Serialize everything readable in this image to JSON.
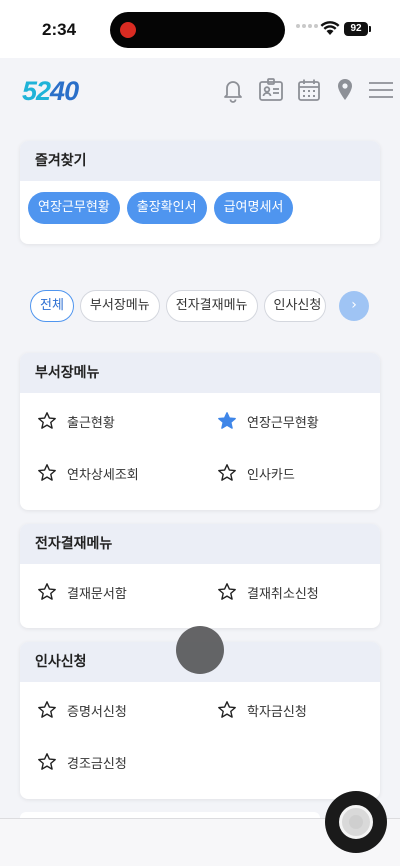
{
  "status": {
    "time": "2:34",
    "battery": "92"
  },
  "brand": {
    "logo_a": "52",
    "logo_b": "40"
  },
  "header_icons": [
    "bell-icon",
    "id-card-icon",
    "calendar-icon",
    "location-pin-icon",
    "hamburger-menu-icon"
  ],
  "favorites": {
    "title": "즐겨찾기",
    "chips": [
      "연장근무현황",
      "출장확인서",
      "급여명세서"
    ]
  },
  "tabs": [
    "전체",
    "부서장메뉴",
    "전자결재메뉴",
    "인사신청"
  ],
  "tab_next_glyph": "›",
  "sections": [
    {
      "title": "부서장메뉴",
      "items": [
        {
          "label": "출근현황",
          "starred": false
        },
        {
          "label": "연장근무현황",
          "starred": true
        },
        {
          "label": "연차상세조회",
          "starred": false
        },
        {
          "label": "인사카드",
          "starred": false
        }
      ]
    },
    {
      "title": "전자결재메뉴",
      "items": [
        {
          "label": "결재문서함",
          "starred": false
        },
        {
          "label": "결재취소신청",
          "starred": false
        }
      ]
    },
    {
      "title": "인사신청",
      "items": [
        {
          "label": "증명서신청",
          "starred": false
        },
        {
          "label": "학자금신청",
          "starred": false
        },
        {
          "label": "경조금신청",
          "starred": false
        }
      ]
    }
  ],
  "colors": {
    "accent": "#4f95ef",
    "star_filled": "#3f86e8",
    "header_bg": "#ebeef6"
  }
}
